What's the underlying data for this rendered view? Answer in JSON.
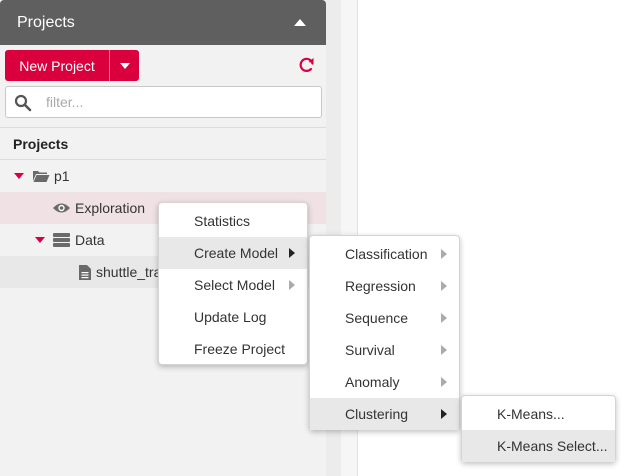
{
  "sidebar": {
    "header_title": "Projects",
    "new_project_label": "New Project",
    "search_placeholder": "filter...",
    "section_title": "Projects",
    "tree": {
      "project": "p1",
      "exploration": "Exploration",
      "data": "Data",
      "file": "shuttle_tra"
    }
  },
  "context_menu": {
    "items": [
      "Statistics",
      "Create Model",
      "Select Model",
      "Update Log",
      "Freeze Project"
    ]
  },
  "create_model_menu": {
    "items": [
      "Classification",
      "Regression",
      "Sequence",
      "Survival",
      "Anomaly",
      "Clustering"
    ]
  },
  "clustering_menu": {
    "items": [
      "K-Means...",
      "K-Means Select..."
    ]
  },
  "colors": {
    "accent": "#d9003d",
    "header": "#5f5f5f"
  }
}
